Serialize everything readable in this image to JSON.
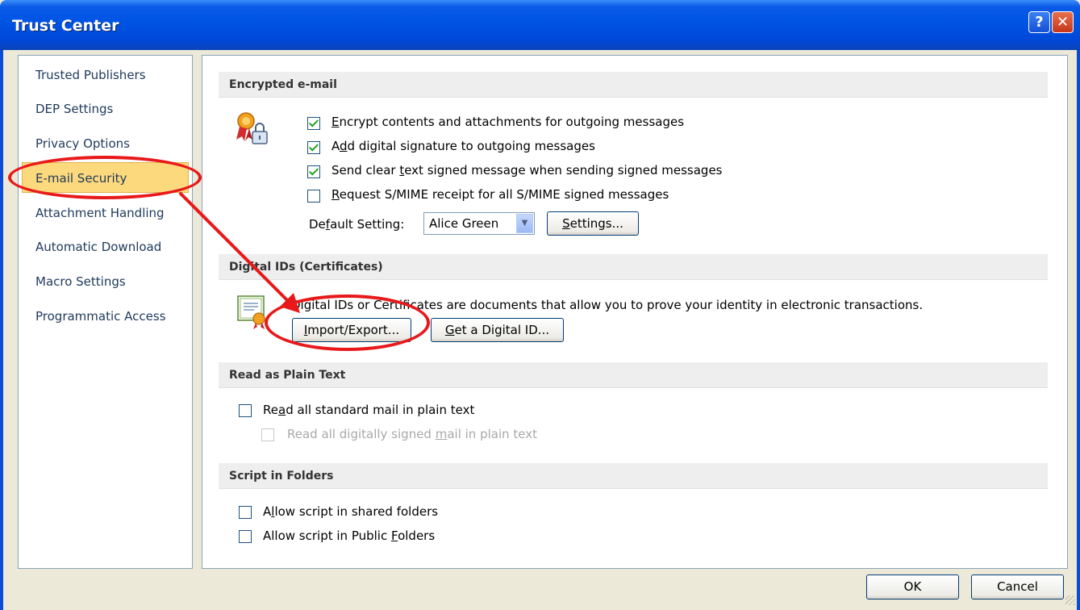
{
  "window": {
    "title": "Trust Center",
    "help_symbol": "?",
    "close_symbol": "✕"
  },
  "sidebar": {
    "items": [
      {
        "label": "Trusted Publishers"
      },
      {
        "label": "DEP Settings"
      },
      {
        "label": "Privacy Options"
      },
      {
        "label": "E-mail Security",
        "selected": true
      },
      {
        "label": "Attachment Handling"
      },
      {
        "label": "Automatic Download"
      },
      {
        "label": "Macro Settings"
      },
      {
        "label": "Programmatic Access"
      }
    ]
  },
  "encrypted": {
    "header": "Encrypted e-mail",
    "icon": "certificate-lock-icon",
    "options": [
      {
        "pre": "",
        "key": "E",
        "post": "ncrypt contents and attachments for outgoing messages",
        "checked": true
      },
      {
        "pre": "A",
        "key": "d",
        "post": "d digital signature to outgoing messages",
        "checked": true
      },
      {
        "pre": "Send clear ",
        "key": "t",
        "post": "ext signed message when sending signed messages",
        "checked": true
      },
      {
        "pre": "",
        "key": "R",
        "post": "equest S/MIME receipt for all S/MIME signed messages",
        "checked": false
      }
    ],
    "default_pre": "De",
    "default_key": "f",
    "default_post": "ault Setting:",
    "default_value": "Alice Green",
    "settings_key": "S",
    "settings_post": "ettings..."
  },
  "digital_ids": {
    "header": "Digital IDs (Certificates)",
    "icon": "digital-certificate-icon",
    "description": "Digital IDs or Certificates are documents that allow you to prove your identity in electronic transactions.",
    "import_key": "I",
    "import_post": "mport/Export...",
    "get_key": "G",
    "get_post": "et a Digital ID..."
  },
  "plain_text": {
    "header": "Read as Plain Text",
    "read_all_pre": "Re",
    "read_all_key": "a",
    "read_all_post": "d all standard mail in plain text",
    "read_signed_pre": "Read all digitally signed ",
    "read_signed_key": "m",
    "read_signed_post": "ail in plain text"
  },
  "scripts": {
    "header": "Script in Folders",
    "shared_pre": "A",
    "shared_key": "l",
    "shared_post": "low script in shared folders",
    "public_pre": "Allow script in Public ",
    "public_key": "F",
    "public_post": "olders"
  },
  "footer": {
    "ok": "OK",
    "cancel": "Cancel"
  },
  "colors": {
    "annotation": "#e8191a",
    "selection": "#fdd97d",
    "titlebar": "#0055e5"
  }
}
